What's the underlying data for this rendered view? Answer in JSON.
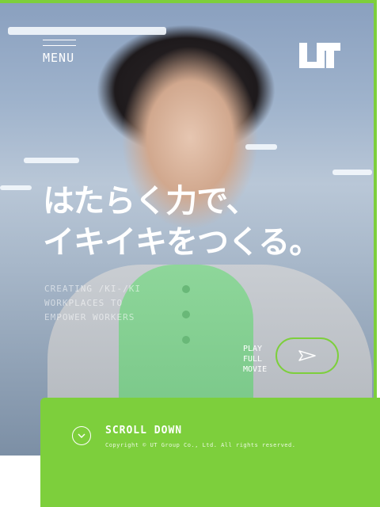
{
  "header": {
    "menu_label": "MENU",
    "logo_name": "UT"
  },
  "hero": {
    "title_line1": "はたらく力で、",
    "title_line2": "イキイキをつくる。",
    "subtitle_line1": "CREATING /KI-/KI WORKPLACES TO",
    "subtitle_line2": "EMPOWER WORKERS"
  },
  "movie": {
    "line1": "PLAY",
    "line2": "FULL",
    "line3": "MOVIE"
  },
  "footer": {
    "scroll_label": "SCROLL DOWN",
    "copyright": "Copyright © UT Group Co., Ltd. All rights reserved."
  },
  "colors": {
    "accent": "#7dcf3c",
    "text": "#ffffff"
  },
  "icons": [
    "ut-logo",
    "play-arrow-icon",
    "chevron-down-icon"
  ]
}
